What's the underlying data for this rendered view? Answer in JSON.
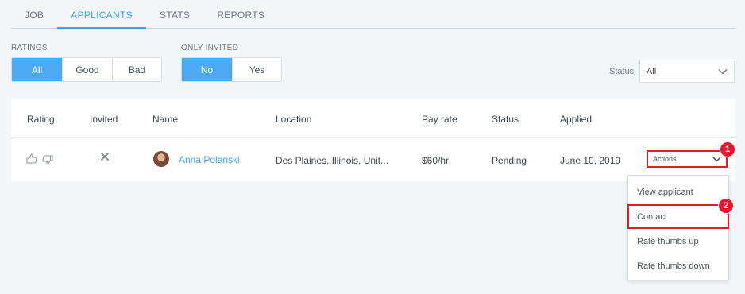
{
  "tabs": [
    "JOB",
    "APPLICANTS",
    "STATS",
    "REPORTS"
  ],
  "active_tab": "APPLICANTS",
  "filters": {
    "ratings": {
      "label": "RATINGS",
      "options": [
        "All",
        "Good",
        "Bad"
      ],
      "selected": "All"
    },
    "only_invited": {
      "label": "ONLY INVITED",
      "options": [
        "No",
        "Yes"
      ],
      "selected": "No"
    },
    "status": {
      "label": "Status",
      "value": "All"
    }
  },
  "table": {
    "headers": [
      "Rating",
      "Invited",
      "Name",
      "Location",
      "Pay rate",
      "Status",
      "Applied"
    ],
    "row": {
      "name": "Anna Polanski",
      "location": "Des Plaines, Illinois, Unit...",
      "pay_rate": "$60/hr",
      "status": "Pending",
      "applied": "June 10, 2019"
    }
  },
  "actions": {
    "label": "Actions",
    "menu": [
      "View applicant",
      "Contact",
      "Rate thumbs up",
      "Rate thumbs down"
    ]
  },
  "annotations": [
    "1",
    "2"
  ],
  "colors": {
    "accent": "#3fa3f3",
    "highlight": "#e2192c"
  },
  "icons": [
    "thumbs-up-icon",
    "thumbs-down-icon",
    "close-icon",
    "chevron-down-icon",
    "avatar"
  ]
}
